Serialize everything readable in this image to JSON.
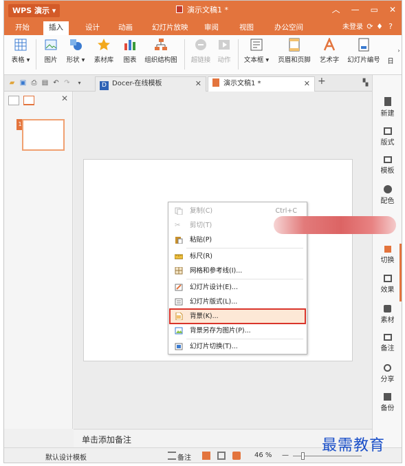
{
  "app": {
    "name": "WPS 演示",
    "doc_title": "演示文稿1 *"
  },
  "menu": {
    "tabs": [
      "开始",
      "插入",
      "设计",
      "动画",
      "幻灯片放映",
      "审阅",
      "视图",
      "办公空间"
    ],
    "active_tab": "插入",
    "login": "未登录"
  },
  "ribbon": {
    "buttons": [
      "表格",
      "图片",
      "形状",
      "素材库",
      "图表",
      "组织结构图",
      "超链接",
      "动作",
      "文本框",
      "页眉和页脚",
      "艺术字",
      "幻灯片编号",
      "日"
    ]
  },
  "tabs": {
    "docer": "Docer-在线模板",
    "doc": "演示文稿1 *"
  },
  "context_menu": {
    "items": [
      {
        "label": "复制(C)",
        "shortcut": "Ctrl+C",
        "disabled": true
      },
      {
        "label": "剪切(T)",
        "disabled": true
      },
      {
        "label": "粘贴(P)"
      },
      {
        "label": "标尺(R)"
      },
      {
        "label": "网格和参考线(I)..."
      },
      {
        "label": "幻灯片设计(E)..."
      },
      {
        "label": "幻灯片版式(L)..."
      },
      {
        "label": "背景(K)...",
        "highlighted": true
      },
      {
        "label": "背景另存为图片(P)..."
      },
      {
        "label": "幻灯片切换(T)..."
      }
    ]
  },
  "right_pane": [
    "新建",
    "版式",
    "模板",
    "配色",
    "切换",
    "效果",
    "素材",
    "备注",
    "分享",
    "备份"
  ],
  "notes_placeholder": "单击添加备注",
  "status": {
    "template": "默认设计模板",
    "notes": "备注",
    "zoom": "46 %"
  },
  "watermark": "最需教育",
  "colors": {
    "accent": "#e3743d",
    "highlight_border": "#d9342b",
    "highlight_fill": "#fde8d6"
  }
}
